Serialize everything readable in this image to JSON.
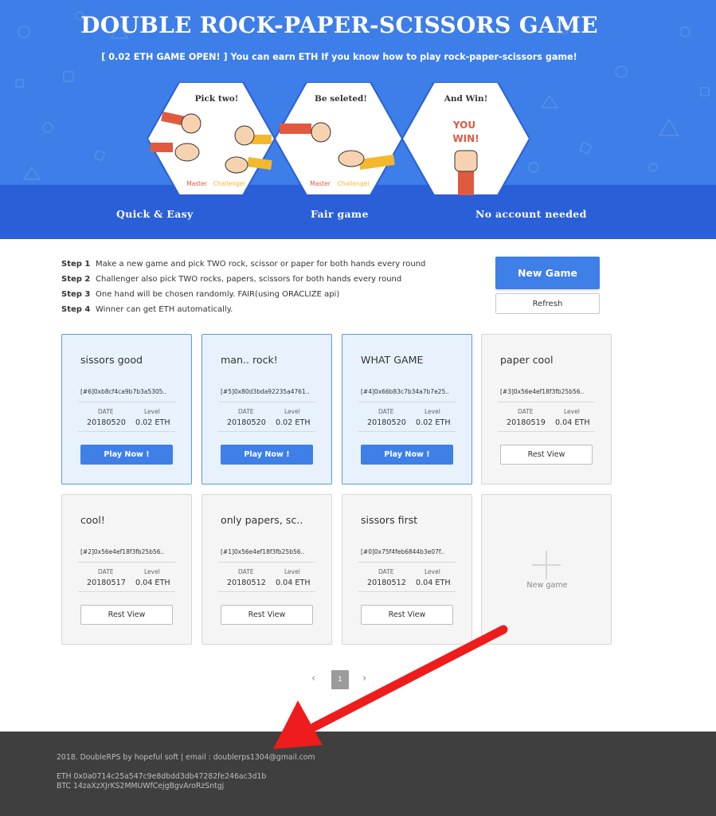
{
  "hero": {
    "title": "DOUBLE ROCK-PAPER-SCISSORS GAME",
    "subtitle": "[ 0.02 ETH GAME OPEN! ] You can earn ETH If you know how to play rock-paper-scissors game!",
    "panels": [
      {
        "caption": "Pick two!",
        "master": "Master",
        "challenger": "Challenger"
      },
      {
        "caption": "Be seleted!",
        "master": "Master",
        "challenger": "Challenger"
      },
      {
        "caption": "And Win!",
        "win_line1": "YOU",
        "win_line2": "WIN!"
      }
    ],
    "features": [
      "Quick & Easy",
      "Fair game",
      "No account needed"
    ],
    "colors": {
      "bg": "#3d7ee8",
      "band": "#2a5fd8",
      "master": "#e05a40",
      "challenger": "#f3b82e"
    }
  },
  "steps": [
    {
      "num": "Step 1",
      "text": "Make a new game and pick TWO rock, scissor or paper for both hands every round"
    },
    {
      "num": "Step 2",
      "text": "Challenger also pick TWO rocks, papers, scissors for both hands every round"
    },
    {
      "num": "Step 3",
      "text": "One hand will be chosen randomly. FAIR(using ORACLIZE api)"
    },
    {
      "num": "Step 4",
      "text": "Winner can get ETH automatically."
    }
  ],
  "actions": {
    "new_game": "New Game",
    "refresh": "Refresh"
  },
  "card_labels": {
    "date": "DATE",
    "level": "Level"
  },
  "games": [
    {
      "title": "sissors good",
      "address": "[#6]0xb8cf4ca9b7b3a5305..",
      "date": "20180520",
      "level": "0.02 ETH",
      "button": "Play Now !",
      "open": true
    },
    {
      "title": "man.. rock!",
      "address": "[#5]0x80d3bda92235a4761..",
      "date": "20180520",
      "level": "0.02 ETH",
      "button": "Play Now !",
      "open": true
    },
    {
      "title": "WHAT GAME",
      "address": "[#4]0x66b83c7b34a7b7e25..",
      "date": "20180520",
      "level": "0.02 ETH",
      "button": "Play Now !",
      "open": true
    },
    {
      "title": "paper cool",
      "address": "[#3]0x56e4ef18f3fb25b56..",
      "date": "20180519",
      "level": "0.04 ETH",
      "button": "Rest View",
      "open": false
    },
    {
      "title": "cool!",
      "address": "[#2]0x56e4ef18f3fb25b56..",
      "date": "20180517",
      "level": "0.04 ETH",
      "button": "Rest View",
      "open": false
    },
    {
      "title": "only papers, sc..",
      "address": "[#1]0x56e4ef18f3fb25b56..",
      "date": "20180512",
      "level": "0.04 ETH",
      "button": "Rest View",
      "open": false
    },
    {
      "title": "sissors first",
      "address": "[#0]0x75f4feb6844b3e07f..",
      "date": "20180512",
      "level": "0.04 ETH",
      "button": "Rest View",
      "open": false
    }
  ],
  "new_game_card": {
    "label": "New game",
    "icon": "plus-icon"
  },
  "pagination": {
    "prev": "‹",
    "current": "1",
    "next": "›"
  },
  "footer": {
    "credits": "2018. DoubleRPS by hopeful soft | email : doublerps1304@gmail.com",
    "eth": "ETH 0x0a0714c25a547c9e8dbdd3db47282fe246ac3d1b",
    "btc": "BTC 14zaXzXJrKS2MMUWfCejgBgvAroRzSntgj"
  },
  "annotation": {
    "arrow_color": "#ee1c1c"
  }
}
